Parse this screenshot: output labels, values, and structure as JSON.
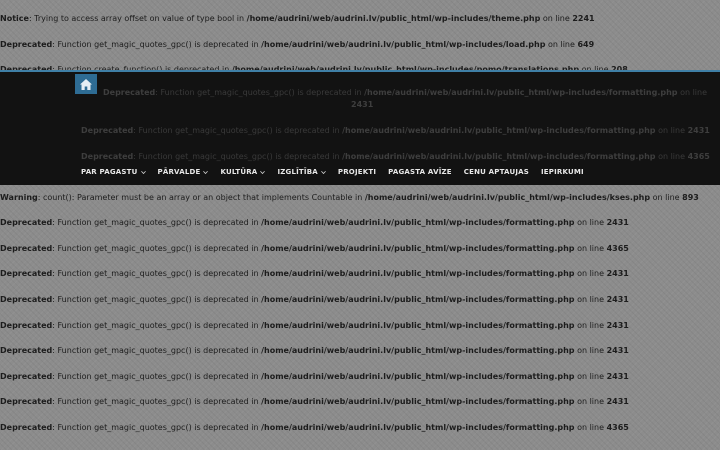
{
  "top_notices": [
    {
      "type": "Notice",
      "text": ": Trying to access array offset on value of type bool in ",
      "path": "/home/audrini/web/audrini.lv/public_html/wp-includes/theme.php",
      "on_line": " on line ",
      "line": "2241"
    },
    {
      "type": "Deprecated",
      "text": ": Function get_magic_quotes_gpc() is deprecated in ",
      "path": "/home/audrini/web/audrini.lv/public_html/wp-includes/load.php",
      "on_line": " on line ",
      "line": "649"
    },
    {
      "type": "Deprecated",
      "text": ": Function create_function() is deprecated in ",
      "path": "/home/audrini/web/audrini.lv/public_html/wp-includes/pomo/translations.php",
      "on_line": " on line ",
      "line": "208"
    }
  ],
  "header_notices": [
    {
      "type": "Deprecated",
      "text": ": Function get_magic_quotes_gpc() is deprecated in ",
      "path": "/home/audrini/web/audrini.lv/public_html/wp-includes/formatting.php",
      "on_line": " on line",
      "line": "2431"
    },
    {
      "type": "Deprecated",
      "text": ": Function get_magic_quotes_gpc() is deprecated in ",
      "path": "/home/audrini/web/audrini.lv/public_html/wp-includes/formatting.php",
      "on_line": " on line ",
      "line": "2431"
    },
    {
      "type": "Deprecated",
      "text": ": Function get_magic_quotes_gpc() is deprecated in ",
      "path": "/home/audrini/web/audrini.lv/public_html/wp-includes/formatting.php",
      "on_line": " on line ",
      "line": "4365"
    }
  ],
  "nav": {
    "home_icon": "home-icon",
    "items": [
      {
        "label": "PAR PAGASTU",
        "dropdown": true
      },
      {
        "label": "PĀRVALDE",
        "dropdown": true
      },
      {
        "label": "KULTŪRA",
        "dropdown": true
      },
      {
        "label": "IZGLĪTĪBA",
        "dropdown": true
      },
      {
        "label": "PROJEKTI",
        "dropdown": false
      },
      {
        "label": "PAGASTA AVĪZE",
        "dropdown": false
      },
      {
        "label": "CENU APTAUJAS",
        "dropdown": false
      },
      {
        "label": "IEPIRKUMI",
        "dropdown": false
      }
    ]
  },
  "bottom_notices": [
    {
      "type": "Warning",
      "text": ": count(): Parameter must be an array or an object that implements Countable in ",
      "path": "/home/audrini/web/audrini.lv/public_html/wp-includes/kses.php",
      "on_line": " on line ",
      "line": "893"
    },
    {
      "type": "Deprecated",
      "text": ": Function get_magic_quotes_gpc() is deprecated in ",
      "path": "/home/audrini/web/audrini.lv/public_html/wp-includes/formatting.php",
      "on_line": " on line ",
      "line": "2431"
    },
    {
      "type": "Deprecated",
      "text": ": Function get_magic_quotes_gpc() is deprecated in ",
      "path": "/home/audrini/web/audrini.lv/public_html/wp-includes/formatting.php",
      "on_line": " on line ",
      "line": "4365"
    },
    {
      "type": "Deprecated",
      "text": ": Function get_magic_quotes_gpc() is deprecated in ",
      "path": "/home/audrini/web/audrini.lv/public_html/wp-includes/formatting.php",
      "on_line": " on line ",
      "line": "2431"
    },
    {
      "type": "Deprecated",
      "text": ": Function get_magic_quotes_gpc() is deprecated in ",
      "path": "/home/audrini/web/audrini.lv/public_html/wp-includes/formatting.php",
      "on_line": " on line ",
      "line": "2431"
    },
    {
      "type": "Deprecated",
      "text": ": Function get_magic_quotes_gpc() is deprecated in ",
      "path": "/home/audrini/web/audrini.lv/public_html/wp-includes/formatting.php",
      "on_line": " on line ",
      "line": "2431"
    },
    {
      "type": "Deprecated",
      "text": ": Function get_magic_quotes_gpc() is deprecated in ",
      "path": "/home/audrini/web/audrini.lv/public_html/wp-includes/formatting.php",
      "on_line": " on line ",
      "line": "2431"
    },
    {
      "type": "Deprecated",
      "text": ": Function get_magic_quotes_gpc() is deprecated in ",
      "path": "/home/audrini/web/audrini.lv/public_html/wp-includes/formatting.php",
      "on_line": " on line ",
      "line": "2431"
    },
    {
      "type": "Deprecated",
      "text": ": Function get_magic_quotes_gpc() is deprecated in ",
      "path": "/home/audrini/web/audrini.lv/public_html/wp-includes/formatting.php",
      "on_line": " on line ",
      "line": "2431"
    },
    {
      "type": "Deprecated",
      "text": ": Function get_magic_quotes_gpc() is deprecated in ",
      "path": "/home/audrini/web/audrini.lv/public_html/wp-includes/formatting.php",
      "on_line": " on line ",
      "line": "4365"
    }
  ],
  "colors": {
    "page_bg": "#8c8c8c",
    "header_bg": "#121212",
    "accent": "#2e6c94"
  }
}
